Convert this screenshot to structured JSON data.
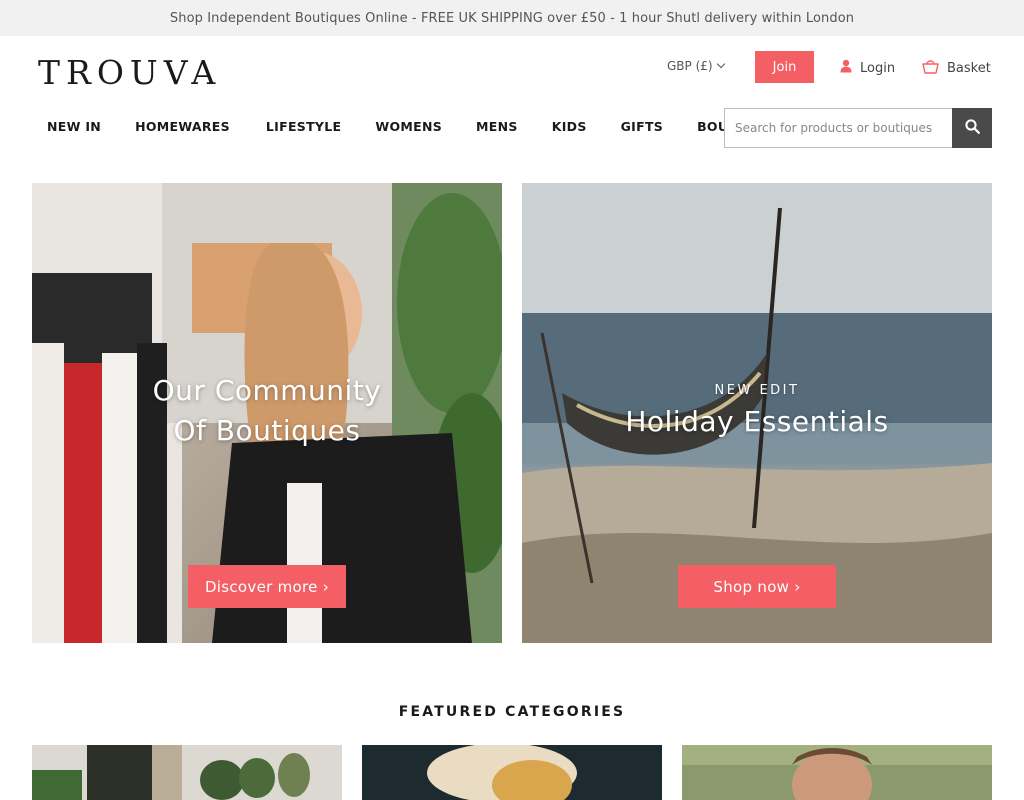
{
  "promo": {
    "text": "Shop Independent Boutiques Online - FREE UK SHIPPING over £50 - 1 hour Shutl delivery within London"
  },
  "header": {
    "logo": "TROUVA",
    "currency": "GBP (£)",
    "join_label": "Join",
    "login_label": "Login",
    "basket_label": "Basket"
  },
  "nav": {
    "items": [
      {
        "label": "NEW IN"
      },
      {
        "label": "HOMEWARES"
      },
      {
        "label": "LIFESTYLE"
      },
      {
        "label": "WOMENS"
      },
      {
        "label": "MENS"
      },
      {
        "label": "KIDS"
      },
      {
        "label": "GIFTS"
      },
      {
        "label": "BOUTIQUES"
      }
    ]
  },
  "search": {
    "placeholder": "Search for products or boutiques",
    "value": ""
  },
  "heroes": [
    {
      "kicker": "",
      "heading_line1": "Our Community",
      "heading_line2": "Of Boutiques",
      "button": "Discover more ›"
    },
    {
      "kicker": "NEW EDIT",
      "heading_line1": "Holiday Essentials",
      "heading_line2": "",
      "button": "Shop now ›"
    }
  ],
  "featured": {
    "title": "FEATURED CATEGORIES"
  },
  "colors": {
    "accent": "#f35f64",
    "search_button": "#4a4a4a",
    "promo_bg": "#f1f1f1"
  },
  "icons": {
    "login": "user-icon",
    "basket": "basket-icon",
    "search": "search-icon",
    "currency": "chevron-down-icon"
  }
}
